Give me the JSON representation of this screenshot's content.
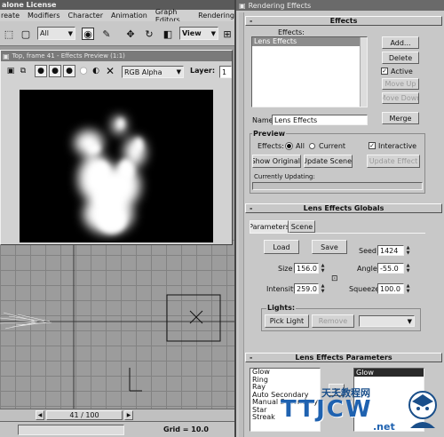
{
  "app": {
    "title_fragment": "alone License",
    "menu": [
      "reate",
      "Modifiers",
      "Character",
      "Animation",
      "Graph Editors",
      "Rendering"
    ],
    "toolbar": {
      "selection_filter": "All",
      "coord_system": "View"
    }
  },
  "preview": {
    "title": "Top, frame 41 - Effects Preview (1:1)",
    "channel": "RGB Alpha",
    "layer_label": "Layer:",
    "layer_value": "1"
  },
  "viewport": {
    "frame_counter": "41 / 100",
    "grid_status": "Grid = 10.0"
  },
  "rendering_effects": {
    "title": "Rendering Effects",
    "effects_section": {
      "header": "Effects",
      "list_label": "Effects:",
      "list_items": [
        "Lens Effects"
      ],
      "add": "Add...",
      "delete": "Delete",
      "active": "Active",
      "move_up": "Move Up",
      "move_down": "Move Down",
      "merge": "Merge",
      "name_label": "Name:",
      "name_value": "Lens Effects"
    },
    "preview_section": {
      "title": "Preview",
      "effects_label": "Effects:",
      "all": "All",
      "current": "Current",
      "interactive": "Interactive",
      "show_original": "Show Original",
      "update_scene": "Update Scene",
      "update_effect": "Update Effect",
      "currently_updating": "Currently Updating:"
    },
    "globals": {
      "header": "Lens Effects Globals",
      "tab_parameters": "Parameters",
      "tab_scene": "Scene",
      "load": "Load",
      "save": "Save",
      "seed_label": "Seed",
      "seed_value": "1424",
      "size_label": "Size",
      "size_value": "156.0",
      "angle_label": "Angle",
      "angle_value": "-55.0",
      "intensity_label": "Intensity",
      "intensity_value": "259.0",
      "squeeze_label": "Squeeze",
      "squeeze_value": "100.0",
      "lights_title": "Lights:",
      "pick_light": "Pick Light",
      "remove": "Remove"
    },
    "params": {
      "header": "Lens Effects Parameters",
      "available": [
        "Glow",
        "Ring",
        "Ray",
        "Auto Secondary",
        "Manual Secondary",
        "Star",
        "Streak"
      ],
      "selected": [
        "Glow"
      ]
    }
  },
  "watermark": {
    "text_cn": "天天教程网",
    "brand": "TTJCW",
    "domain": ".net"
  }
}
